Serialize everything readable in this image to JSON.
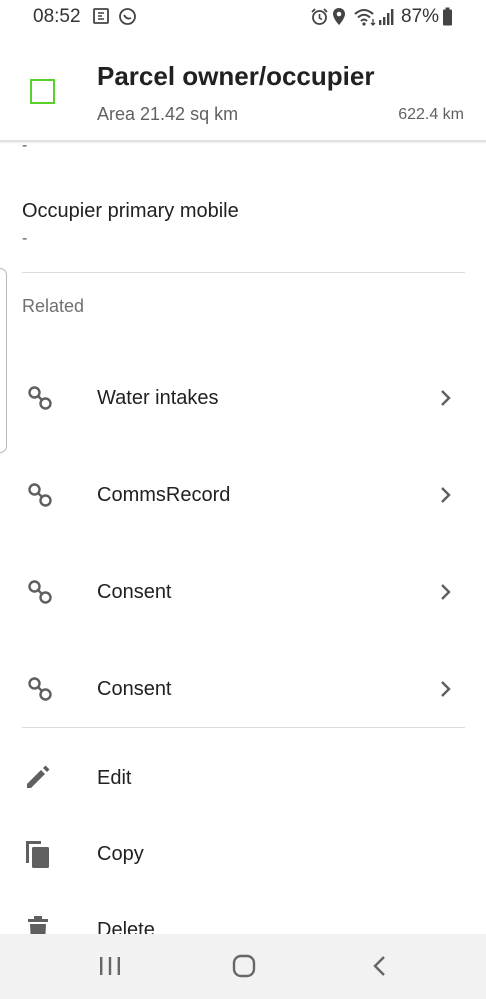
{
  "status_bar": {
    "time": "08:52",
    "battery": "87%",
    "icons": [
      "calendar-icon",
      "whatsapp-icon",
      "alarm-icon",
      "location-icon",
      "wifi-icon",
      "signal-icon",
      "battery-icon"
    ]
  },
  "header": {
    "title": "Parcel owner/occupier",
    "subtitle": "Area 21.42 sq km",
    "distance": "622.4 km",
    "symbol_color": "#5ad02a"
  },
  "previous_value": "-",
  "attribute": {
    "label": "Occupier primary mobile",
    "value": "-"
  },
  "related": {
    "title": "Related",
    "items": [
      {
        "label": "Water intakes",
        "icon": "link-icon"
      },
      {
        "label": "CommsRecord",
        "icon": "link-icon"
      },
      {
        "label": "Consent",
        "icon": "link-icon"
      },
      {
        "label": "Consent",
        "icon": "link-icon"
      }
    ]
  },
  "actions": [
    {
      "label": "Edit",
      "icon": "pencil-icon"
    },
    {
      "label": "Copy",
      "icon": "copy-icon"
    },
    {
      "label": "Delete",
      "icon": "trash-icon"
    }
  ],
  "nav": [
    "recents-icon",
    "home-icon",
    "back-icon"
  ]
}
